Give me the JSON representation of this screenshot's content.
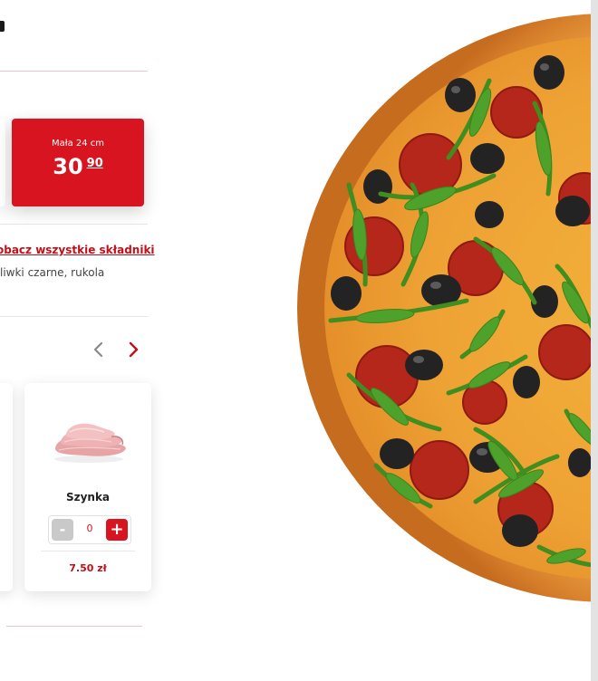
{
  "size_option": {
    "label": "Mała 24 cm",
    "price_main": "30",
    "price_cents": "90"
  },
  "ingredients": {
    "link_label": "obacz wszystkie składniki",
    "list_text": "liwki czarne, rukola"
  },
  "addons": [
    {
      "name": "Szynka",
      "quantity": "0",
      "price": "7.50 zł",
      "minus_label": "-",
      "plus_label": "+"
    }
  ],
  "colors": {
    "accent": "#d7141f",
    "link": "#c0101a"
  },
  "icons": {
    "prev": "chevron-left-icon",
    "next": "chevron-right-icon"
  }
}
